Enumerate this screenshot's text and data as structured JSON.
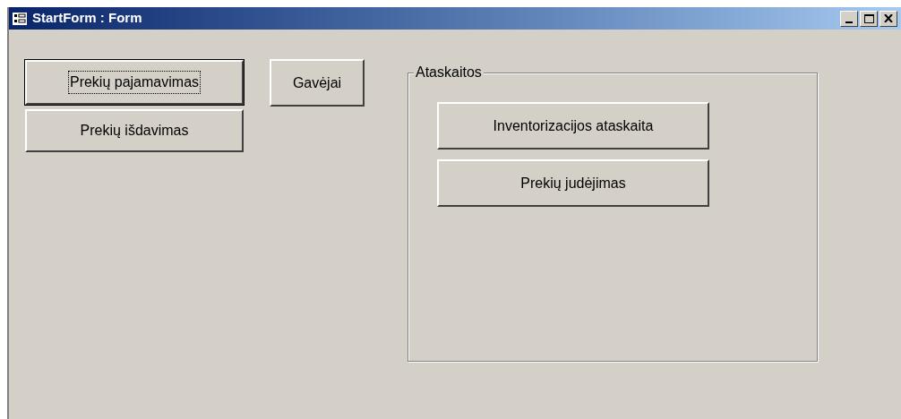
{
  "window": {
    "title": "StartForm : Form"
  },
  "buttons": [
    {
      "label": "Prekių pajamavimas",
      "focused": true
    },
    {
      "label": "Prekių išdavimas",
      "focused": false
    },
    {
      "label": "Gavėjai",
      "focused": false
    }
  ],
  "group": {
    "label": "Ataskaitos",
    "buttons": [
      {
        "label": "Inventorizacijos ataskaita",
        "focused": false
      },
      {
        "label": "Prekių judėjimas",
        "focused": false
      }
    ]
  }
}
